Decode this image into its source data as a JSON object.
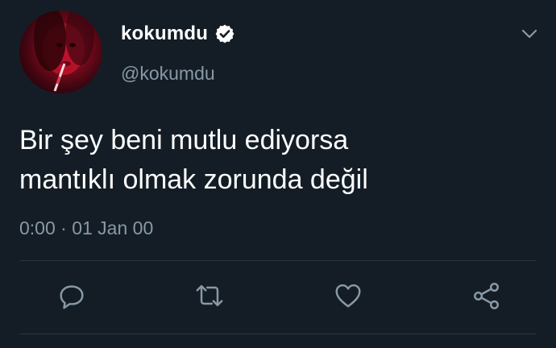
{
  "user": {
    "display_name": "kokumdu",
    "handle": "@kokumdu",
    "verified": true,
    "avatar": "profile-photo"
  },
  "tweet": {
    "text_lines": [
      "Bir şey beni mutlu ediyorsa",
      "mantıklı olmak zorunda değil"
    ],
    "timestamp": "0:00 · 01 Jan 00"
  },
  "actions": [
    {
      "name": "reply",
      "icon": "reply-icon"
    },
    {
      "name": "retweet",
      "icon": "retweet-icon"
    },
    {
      "name": "like",
      "icon": "heart-icon"
    },
    {
      "name": "share",
      "icon": "share-icon"
    }
  ],
  "colors": {
    "background": "#141d26",
    "text_primary": "#ffffff",
    "text_secondary": "#8899a6",
    "divider": "#2b3640",
    "icon": "#8899a6"
  }
}
